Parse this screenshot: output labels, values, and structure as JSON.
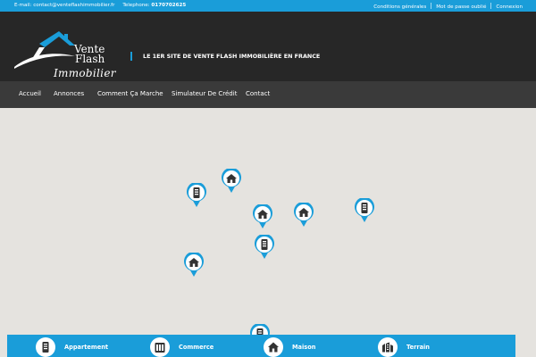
{
  "topbar": {
    "email_text": "E-mail: contact@venteflashimmobilier.fr",
    "phone_label": "Telephone: ",
    "phone_number": "0170702625",
    "links": [
      "Conditions générales",
      "Mot de passe oublié",
      "Connexion"
    ]
  },
  "header": {
    "logo": {
      "line1": "Vente",
      "line2": "Flash",
      "line3": "Immobilier"
    },
    "tagline": "LE 1ER SITE DE VENTE FLASH IMMOBILIÈRE EN FRANCE"
  },
  "nav": {
    "items": [
      "Accueil",
      "Annonces",
      "Comment Ça Marche",
      "Simulateur De Crédit",
      "Contact"
    ]
  },
  "map": {
    "markers": [
      {
        "type": "appartement-icon"
      },
      {
        "type": "maison-icon"
      },
      {
        "type": "maison-icon"
      },
      {
        "type": "maison-icon"
      },
      {
        "type": "appartement-icon"
      },
      {
        "type": "appartement-icon"
      },
      {
        "type": "maison-icon"
      },
      {
        "type": "appartement-icon"
      }
    ]
  },
  "categories": {
    "items": [
      "Appartement",
      "Commerce",
      "Maison",
      "Terrain"
    ]
  },
  "colors": {
    "accent": "#1a9dd9",
    "header_bg": "#272727",
    "nav_bg": "#3a3a3a",
    "map_bg": "#e5e3df"
  }
}
